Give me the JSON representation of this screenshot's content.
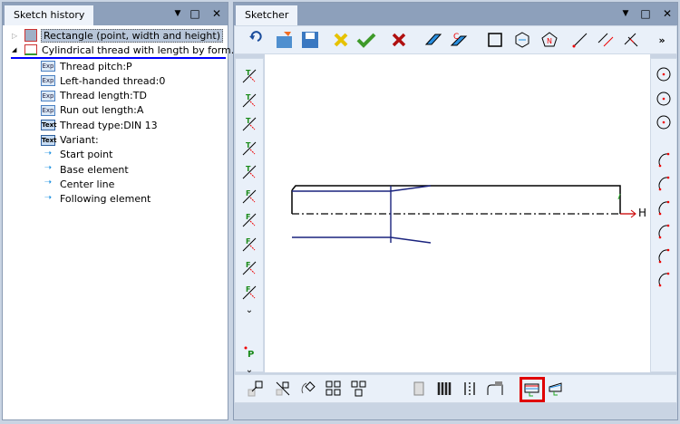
{
  "history": {
    "title": "Sketch history",
    "items": [
      {
        "label": "Rectangle (point, width and height)",
        "icon": "rectangle-icon",
        "expanded": false,
        "selected": true
      },
      {
        "label": "Cylindrical thread with length by form...",
        "icon": "thread-icon",
        "expanded": true
      }
    ],
    "children": [
      {
        "label": "Thread pitch:P",
        "icon": "Exp"
      },
      {
        "label": "Left-handed thread:0",
        "icon": "Exp"
      },
      {
        "label": "Thread length:TD",
        "icon": "Exp"
      },
      {
        "label": "Run out length:A",
        "icon": "Exp"
      },
      {
        "label": "Thread type:DIN 13",
        "icon": "Text"
      },
      {
        "label": "Variant:",
        "icon": "Text"
      },
      {
        "label": "Start point",
        "icon": "arrow"
      },
      {
        "label": "Base element",
        "icon": "arrow"
      },
      {
        "label": "Center line",
        "icon": "arrow"
      },
      {
        "label": "Following element",
        "icon": "arrow"
      }
    ]
  },
  "sketcher": {
    "title": "Sketcher",
    "overflow": "»",
    "more": "»",
    "axis_label": "H",
    "left_more": "⌄"
  },
  "window": {
    "dropdown": "▼",
    "maximize": "□",
    "close": "✕"
  },
  "colors": {
    "accent": "#0000ff",
    "highlight": "#e00000",
    "header": "#8da0bb"
  }
}
